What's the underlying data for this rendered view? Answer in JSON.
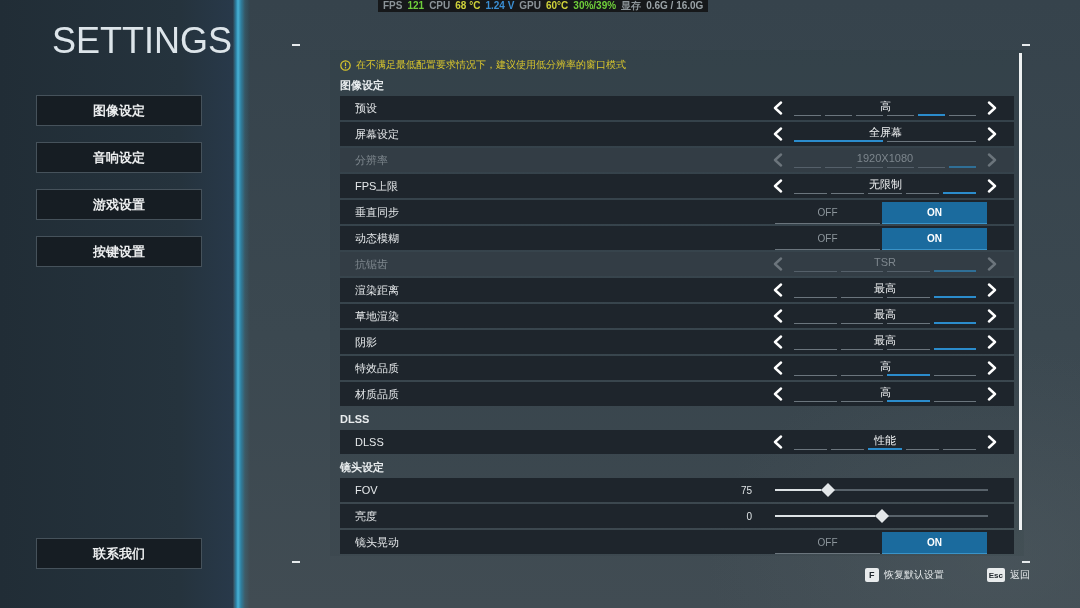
{
  "perf_overlay": {
    "items": [
      {
        "text": "FPS",
        "color": "#8c9499"
      },
      {
        "text": "121",
        "color": "#6fcf3a"
      },
      {
        "text": "CPU",
        "color": "#8c9499"
      },
      {
        "text": "68 °C",
        "color": "#cfd23a"
      },
      {
        "text": "1.24 V",
        "color": "#3b8fd4"
      },
      {
        "text": "GPU",
        "color": "#8c9499"
      },
      {
        "text": "60°C",
        "color": "#cfd23a"
      },
      {
        "text": "30%/39%",
        "color": "#6fcf3a"
      },
      {
        "text": "显存",
        "color": "#8c9499"
      },
      {
        "text": "0.6G / 16.0G",
        "color": "#9aa2a6"
      }
    ]
  },
  "sidebar": {
    "title": "SETTINGS",
    "items": [
      {
        "label": "图像设定"
      },
      {
        "label": "音响设定"
      },
      {
        "label": "游戏设置"
      },
      {
        "label": "按键设置"
      }
    ],
    "contact": {
      "label": "联系我们"
    }
  },
  "warning": {
    "text": "在不满足最低配置要求情况下，建议使用低分辨率的窗口模式"
  },
  "sections": [
    {
      "title": "图像设定",
      "rows": [
        {
          "kind": "selector",
          "label": "预设",
          "value": "高",
          "disabled": false,
          "segments": [
            {
              "selected": false
            },
            {
              "selected": false
            },
            {
              "selected": false
            },
            {
              "selected": false
            },
            {
              "selected": true
            },
            {
              "selected": false
            }
          ]
        },
        {
          "kind": "selector",
          "label": "屏幕设定",
          "value": "全屏幕",
          "disabled": false,
          "segments": [
            {
              "selected": true
            },
            {
              "selected": false
            }
          ]
        },
        {
          "kind": "selector",
          "label": "分辨率",
          "value": "1920X1080",
          "disabled": true,
          "segments": [
            {
              "selected": false
            },
            {
              "selected": false
            },
            {
              "selected": false
            },
            {
              "selected": false
            },
            {
              "selected": false
            },
            {
              "selected": true
            }
          ]
        },
        {
          "kind": "selector",
          "label": "FPS上限",
          "value": "无限制",
          "disabled": false,
          "segments": [
            {
              "selected": false
            },
            {
              "selected": false
            },
            {
              "selected": false
            },
            {
              "selected": false
            },
            {
              "selected": true
            }
          ]
        },
        {
          "kind": "toggle",
          "label": "垂直同步",
          "disabled": false,
          "options": [
            {
              "label": "OFF",
              "selected": false
            },
            {
              "label": "ON",
              "selected": true
            }
          ]
        },
        {
          "kind": "toggle",
          "label": "动态模糊",
          "disabled": false,
          "options": [
            {
              "label": "OFF",
              "selected": false
            },
            {
              "label": "ON",
              "selected": true
            }
          ]
        },
        {
          "kind": "selector",
          "label": "抗锯齿",
          "value": "TSR",
          "disabled": true,
          "segments": [
            {
              "selected": false
            },
            {
              "selected": false
            },
            {
              "selected": false
            },
            {
              "selected": true
            }
          ]
        },
        {
          "kind": "selector",
          "label": "渲染距离",
          "value": "最高",
          "disabled": false,
          "segments": [
            {
              "selected": false
            },
            {
              "selected": false
            },
            {
              "selected": false
            },
            {
              "selected": true
            }
          ]
        },
        {
          "kind": "selector",
          "label": "草地渲染",
          "value": "最高",
          "disabled": false,
          "segments": [
            {
              "selected": false
            },
            {
              "selected": false
            },
            {
              "selected": false
            },
            {
              "selected": true
            }
          ]
        },
        {
          "kind": "selector",
          "label": "阴影",
          "value": "最高",
          "disabled": false,
          "segments": [
            {
              "selected": false
            },
            {
              "selected": false
            },
            {
              "selected": false
            },
            {
              "selected": true
            }
          ]
        },
        {
          "kind": "selector",
          "label": "特效品质",
          "value": "高",
          "disabled": false,
          "segments": [
            {
              "selected": false
            },
            {
              "selected": false
            },
            {
              "selected": true
            },
            {
              "selected": false
            }
          ]
        },
        {
          "kind": "selector",
          "label": "材质品质",
          "value": "高",
          "disabled": false,
          "segments": [
            {
              "selected": false
            },
            {
              "selected": false
            },
            {
              "selected": true
            },
            {
              "selected": false
            }
          ]
        }
      ]
    },
    {
      "title": "DLSS",
      "rows": [
        {
          "kind": "selector",
          "label": "DLSS",
          "value": "性能",
          "disabled": false,
          "segments": [
            {
              "selected": false
            },
            {
              "selected": false
            },
            {
              "selected": true
            },
            {
              "selected": false
            },
            {
              "selected": false
            }
          ]
        }
      ]
    },
    {
      "title": "镜头设定",
      "rows": [
        {
          "kind": "slider",
          "label": "FOV",
          "reading": "75",
          "level": 0.25,
          "disabled": false
        },
        {
          "kind": "slider",
          "label": "亮度",
          "reading": "0",
          "level": 0.5,
          "disabled": false
        },
        {
          "kind": "toggle",
          "label": "镜头晃动",
          "disabled": false,
          "options": [
            {
              "label": "OFF",
              "selected": false
            },
            {
              "label": "ON",
              "selected": true
            }
          ]
        }
      ]
    }
  ],
  "footer": {
    "hints": [
      {
        "key": "F",
        "label": "恢复默认设置"
      },
      {
        "key": "Esc",
        "label": "返回"
      }
    ]
  }
}
